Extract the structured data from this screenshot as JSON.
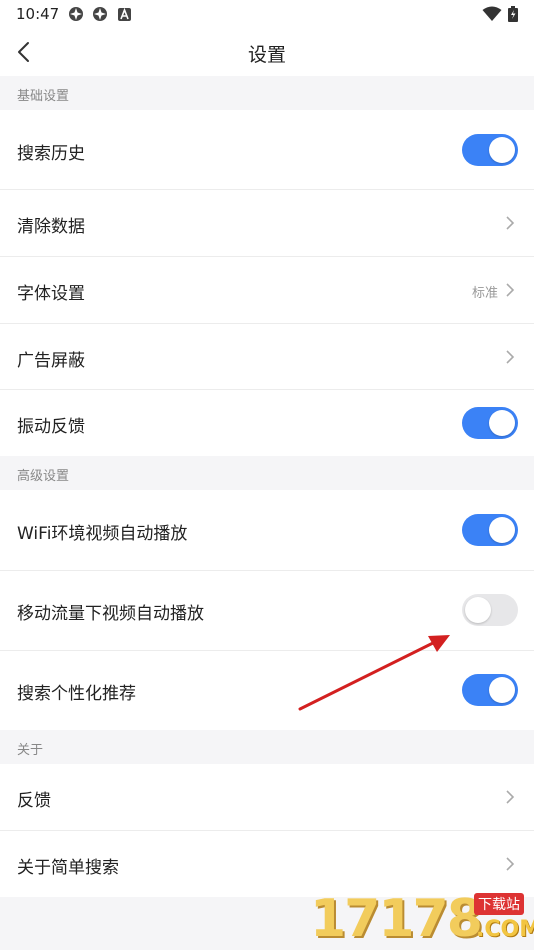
{
  "status_bar": {
    "time": "10:47"
  },
  "header": {
    "title": "设置"
  },
  "sections": [
    {
      "title": "基础设置"
    },
    {
      "title": "高级设置"
    },
    {
      "title": "关于"
    }
  ],
  "rows": [
    {
      "label": "搜索历史",
      "toggle": true
    },
    {
      "label": "清除数据"
    },
    {
      "label": "字体设置",
      "value": "标准"
    },
    {
      "label": "广告屏蔽"
    },
    {
      "label": "振动反馈",
      "toggle": true
    },
    {
      "label": "WiFi环境视频自动播放",
      "toggle": true
    },
    {
      "label": "移动流量下视频自动播放",
      "toggle": false
    },
    {
      "label": "搜索个性化推荐",
      "toggle": true
    },
    {
      "label": "反馈"
    },
    {
      "label": "关于简单搜索"
    }
  ],
  "watermark": {
    "digits": "17178",
    "tag": "下载站",
    "suffix": ".COM"
  },
  "colors": {
    "accent": "#3b82f6",
    "annotation_arrow": "#d32020"
  }
}
